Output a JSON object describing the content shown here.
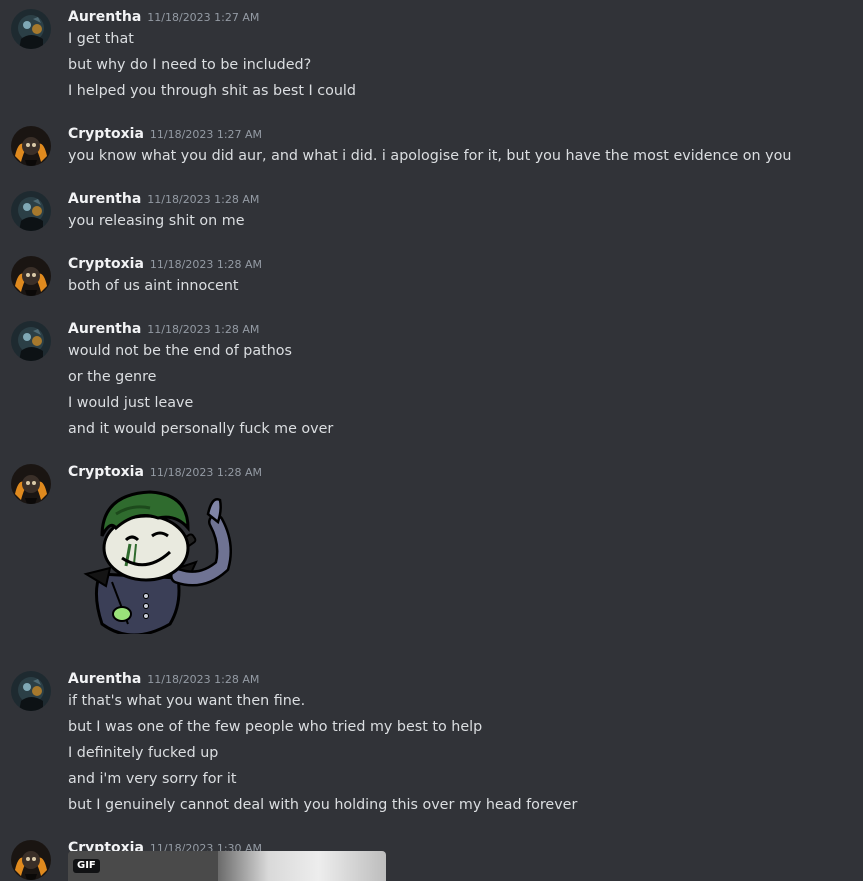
{
  "users": {
    "aurentha": "Aurentha",
    "cryptoxia": "Cryptoxia"
  },
  "messages": [
    {
      "author": "Aurentha",
      "timestamp": "11/18/2023 1:27 AM",
      "lines": [
        "I get that",
        "but why do I need to be included?",
        "I helped you through shit as best I could"
      ]
    },
    {
      "author": "Cryptoxia",
      "timestamp": "11/18/2023 1:27 AM",
      "lines": [
        "you know what you did aur, and what i did. i apologise for it, but you have the most evidence on you"
      ]
    },
    {
      "author": "Aurentha",
      "timestamp": "11/18/2023 1:28 AM",
      "lines": [
        "you releasing shit on me"
      ]
    },
    {
      "author": "Cryptoxia",
      "timestamp": "11/18/2023 1:28 AM",
      "lines": [
        "both of us aint innocent"
      ]
    },
    {
      "author": "Aurentha",
      "timestamp": "11/18/2023 1:28 AM",
      "lines": [
        "would not be the end of pathos",
        "or the genre",
        "I would just leave",
        "and it would personally fuck me over"
      ]
    },
    {
      "author": "Cryptoxia",
      "timestamp": "11/18/2023 1:28 AM",
      "sticker": "joker-sticker"
    },
    {
      "author": "Aurentha",
      "timestamp": "11/18/2023 1:28 AM",
      "lines": [
        "if that's what you want then fine.",
        "but I was one of the few people who tried my best to help",
        "I definitely fucked up",
        "and i'm very sorry for it",
        "but I genuinely cannot deal with you holding this over my head forever"
      ]
    },
    {
      "author": "Cryptoxia",
      "timestamp": "11/18/2023 1:30 AM",
      "gif_badge": "GIF"
    }
  ],
  "colors": {
    "background": "#313338",
    "username": "#f2f3f5",
    "timestamp": "#949ba4",
    "message_text": "#dbdee1"
  }
}
